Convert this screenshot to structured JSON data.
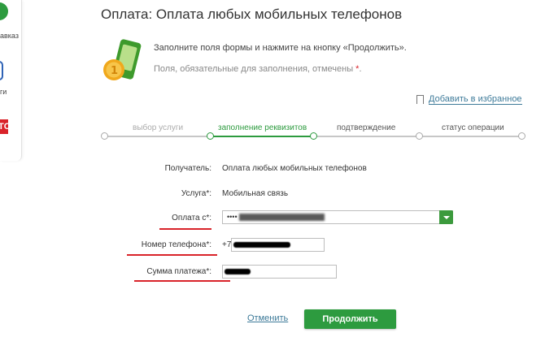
{
  "sidebar": {
    "items": [
      {
        "label": "авказ"
      },
      {
        "label": "ги"
      },
      {
        "label": "ТС"
      }
    ]
  },
  "page": {
    "title": "Оплата: Оплата любых мобильных телефонов"
  },
  "info": {
    "line1": "Заполните поля формы и нажмите на кнопку «Продолжить».",
    "line2": "Поля, обязательные для заполнения, отмечены",
    "required_mark": "*",
    "line2_end": "."
  },
  "favorites": {
    "label": "Добавить в избранное"
  },
  "steps": [
    {
      "label": "выбор услуги",
      "state": "done"
    },
    {
      "label": "заполнение реквизитов",
      "state": "active"
    },
    {
      "label": "подтверждение",
      "state": "pending"
    },
    {
      "label": "статус операции",
      "state": "pending"
    }
  ],
  "form": {
    "recipient": {
      "label": "Получатель:",
      "value": "Оплата любых мобильных телефонов"
    },
    "service": {
      "label": "Услуга*:",
      "value": "Мобильная связь"
    },
    "pay_from": {
      "label": "Оплата с*:",
      "value": "••••"
    },
    "phone": {
      "label": "Номер телефона*:",
      "prefix": "+7"
    },
    "amount": {
      "label": "Сумма платежа*:"
    }
  },
  "actions": {
    "cancel": "Отменить",
    "continue": "Продолжить"
  },
  "colors": {
    "accent_green": "#2d9b3f",
    "link_blue": "#3d7a99",
    "required_red": "#d9232a"
  }
}
